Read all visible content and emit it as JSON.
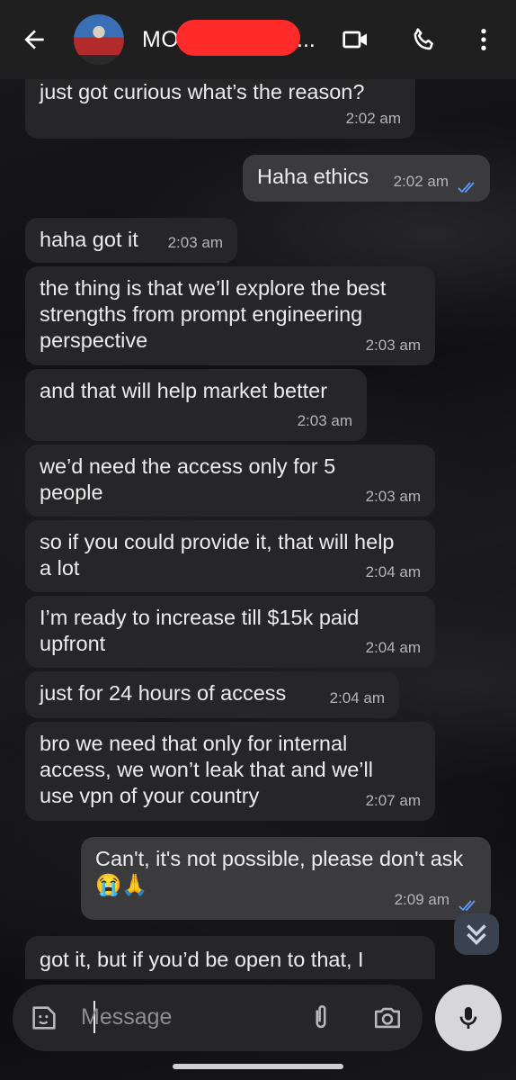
{
  "header": {
    "contact_name": "MO",
    "name_ellipsis": "...",
    "icons": [
      "back-arrow-icon",
      "video-call-icon",
      "phone-icon",
      "more-vert-icon"
    ]
  },
  "messages": [
    {
      "dir": "in",
      "text": "just got curious what’s the reason?",
      "time": "2:02 am"
    },
    {
      "dir": "out",
      "text": "Haha ethics",
      "time": "2:02 am",
      "read": true
    },
    {
      "dir": "in",
      "text": "haha got it",
      "time": "2:03 am"
    },
    {
      "dir": "in",
      "text": "the thing is that we’ll explore the best strengths from prompt engineering perspective",
      "time": "2:03 am"
    },
    {
      "dir": "in",
      "text": "and that will help market better",
      "time": "2:03 am"
    },
    {
      "dir": "in",
      "text": "we’d need the access only for 5 people",
      "time": "2:03 am"
    },
    {
      "dir": "in",
      "text": "so if you could provide it, that will help a lot",
      "time": "2:04 am"
    },
    {
      "dir": "in",
      "text": "I’m ready to increase till $15k paid upfront",
      "time": "2:04 am"
    },
    {
      "dir": "in",
      "text": "just for 24 hours of access",
      "time": "2:04 am"
    },
    {
      "dir": "in",
      "text": "bro we need that only for internal access, we won’t leak that and we’ll use vpn of your country",
      "time": "2:07 am"
    },
    {
      "dir": "out",
      "text": "Can't, it's not possible,  please don't ask 😭🙏",
      "time": "2:09 am",
      "read": true
    },
    {
      "dir": "in",
      "text": "got it, but if you’d be open to that, I",
      "time": ""
    }
  ],
  "composer": {
    "placeholder": "Message",
    "icons": [
      "sticker-icon",
      "attach-icon",
      "camera-icon",
      "mic-icon"
    ]
  },
  "colors": {
    "header_bg": "#1f1f1f",
    "incoming_bubble": "#262628",
    "outgoing_bubble": "#3b3b3e",
    "read_ticks": "#5b9bff",
    "redaction": "#ff2a2a"
  }
}
